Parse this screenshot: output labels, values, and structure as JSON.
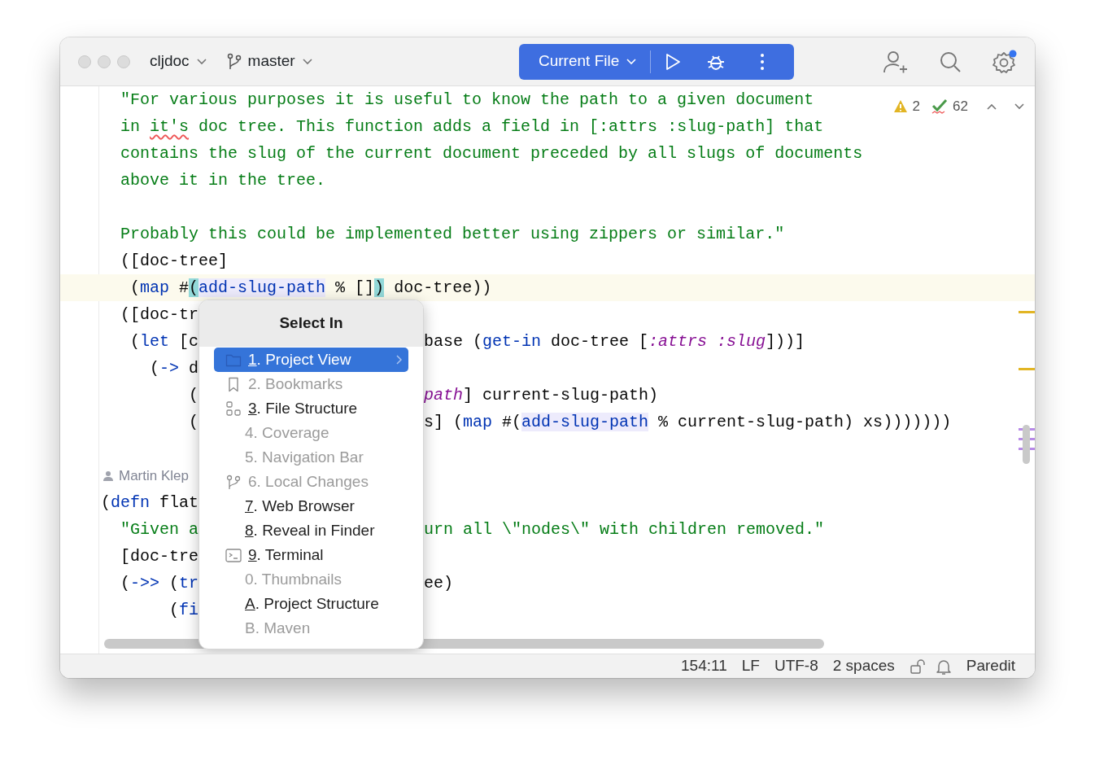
{
  "window": {
    "project": "cljdoc",
    "branch": "master",
    "run_config": "Current File"
  },
  "inspections": {
    "warnings": "2",
    "checks": "62"
  },
  "code_lines": [
    {
      "kind": "code",
      "current": false,
      "tokens": [
        {
          "kind": "string",
          "t": "  \"For various purposes it is useful to know the path to a given document"
        }
      ]
    },
    {
      "kind": "code",
      "current": false,
      "tokens": [
        {
          "kind": "string",
          "t": "  in "
        },
        {
          "kind": "typo",
          "t": "it's"
        },
        {
          "kind": "string",
          "t": " doc tree. This function adds a field in [:attrs :slug-path] that"
        }
      ]
    },
    {
      "kind": "code",
      "current": false,
      "tokens": [
        {
          "kind": "string",
          "t": "  contains the slug of the current document preceded by all slugs of documents"
        }
      ]
    },
    {
      "kind": "code",
      "current": false,
      "tokens": [
        {
          "kind": "string",
          "t": "  above it in the tree."
        }
      ]
    },
    {
      "kind": "blank",
      "current": false
    },
    {
      "kind": "code",
      "current": false,
      "tokens": [
        {
          "kind": "string",
          "t": "  Probably this could be implemented better using zippers or similar.\""
        }
      ]
    },
    {
      "kind": "code",
      "current": false,
      "tokens": [
        {
          "kind": "plain",
          "t": "  ([doc-tree]"
        }
      ]
    },
    {
      "kind": "code",
      "current": true,
      "tokens": [
        {
          "kind": "plain",
          "t": "   ("
        },
        {
          "kind": "call",
          "t": "map"
        },
        {
          "kind": "plain",
          "t": " #"
        },
        {
          "kind": "brace",
          "t": "("
        },
        {
          "kind": "usage",
          "t": "add-slug-path"
        },
        {
          "kind": "plain",
          "t": " % []"
        },
        {
          "kind": "brace",
          "t": ")"
        },
        {
          "kind": "plain",
          "t": " doc-tree))"
        }
      ]
    },
    {
      "kind": "split",
      "current": false,
      "left": [
        {
          "kind": "plain",
          "t": "  ([doc-tr"
        }
      ]
    },
    {
      "kind": "split",
      "current": false,
      "left": [
        {
          "kind": "plain",
          "t": "   ("
        },
        {
          "kind": "call",
          "t": "let"
        },
        {
          "kind": "plain",
          "t": " [c"
        }
      ],
      "right": [
        {
          "kind": "plain",
          "t": "base ("
        },
        {
          "kind": "call",
          "t": "get-in"
        },
        {
          "kind": "plain",
          "t": " doc-tree ["
        },
        {
          "kind": "keyword",
          "t": ":attrs :slug"
        },
        {
          "kind": "plain",
          "t": "]))]"
        }
      ]
    },
    {
      "kind": "split",
      "current": false,
      "left": [
        {
          "kind": "plain",
          "t": "     ("
        },
        {
          "kind": "call",
          "t": "->"
        },
        {
          "kind": "plain",
          "t": " d"
        }
      ]
    },
    {
      "kind": "split",
      "current": false,
      "left": [
        {
          "kind": "plain",
          "t": "         ("
        }
      ],
      "right": [
        {
          "kind": "keyword",
          "t": "path"
        },
        {
          "kind": "plain",
          "t": "] current-slug-path)"
        }
      ]
    },
    {
      "kind": "split",
      "current": false,
      "left": [
        {
          "kind": "plain",
          "t": "         ("
        }
      ],
      "right": [
        {
          "kind": "plain",
          "t": "s] ("
        },
        {
          "kind": "call",
          "t": "map"
        },
        {
          "kind": "plain",
          "t": " #("
        },
        {
          "kind": "usage",
          "t": "add-slug-path"
        },
        {
          "kind": "plain",
          "t": " % current-slug-path) xs)))))))"
        }
      ]
    },
    {
      "kind": "blank",
      "current": false
    },
    {
      "kind": "author",
      "current": false,
      "text": "Martin Klep"
    },
    {
      "kind": "split",
      "current": false,
      "left": [
        {
          "kind": "plain",
          "t": "("
        },
        {
          "kind": "call",
          "t": "defn"
        },
        {
          "kind": "plain",
          "t": " flat"
        }
      ]
    },
    {
      "kind": "split",
      "current": false,
      "left": [
        {
          "kind": "string",
          "t": "  \"Given a"
        }
      ],
      "right": [
        {
          "kind": "string",
          "t": "urn all \\\"nodes\\\" with children removed.\""
        }
      ]
    },
    {
      "kind": "split",
      "current": false,
      "left": [
        {
          "kind": "plain",
          "t": "  [doc-tre"
        }
      ]
    },
    {
      "kind": "split",
      "current": false,
      "left": [
        {
          "kind": "plain",
          "t": "  ("
        },
        {
          "kind": "call",
          "t": "->>"
        },
        {
          "kind": "plain",
          "t": " ("
        },
        {
          "kind": "call",
          "t": "tr"
        }
      ],
      "right": [
        {
          "kind": "plain",
          "t": "ee)"
        }
      ]
    },
    {
      "kind": "split",
      "current": false,
      "left": [
        {
          "kind": "plain",
          "t": "       ("
        },
        {
          "kind": "call",
          "t": "fi"
        }
      ]
    }
  ],
  "popup": {
    "title": "Select In",
    "items": [
      {
        "kind": "folder",
        "label": "1. Project View",
        "enabled": true,
        "selected": true,
        "submenu": true
      },
      {
        "kind": "bookmark",
        "label": "2. Bookmarks",
        "enabled": false,
        "selected": false,
        "submenu": false
      },
      {
        "kind": "structure",
        "label": "3. File Structure",
        "enabled": true,
        "selected": false,
        "submenu": false
      },
      {
        "kind": "plain",
        "label": "4. Coverage",
        "enabled": false,
        "selected": false,
        "submenu": false
      },
      {
        "kind": "plain",
        "label": "5. Navigation Bar",
        "enabled": false,
        "selected": false,
        "submenu": false
      },
      {
        "kind": "branch",
        "label": "6. Local Changes",
        "enabled": false,
        "selected": false,
        "submenu": false
      },
      {
        "kind": "plain",
        "label": "7. Web Browser",
        "enabled": true,
        "selected": false,
        "submenu": false
      },
      {
        "kind": "plain",
        "label": "8. Reveal in Finder",
        "enabled": true,
        "selected": false,
        "submenu": false
      },
      {
        "kind": "terminal",
        "label": "9. Terminal",
        "enabled": true,
        "selected": false,
        "submenu": false
      },
      {
        "kind": "plain",
        "label": "0. Thumbnails",
        "enabled": false,
        "selected": false,
        "submenu": false
      },
      {
        "kind": "plain",
        "label": "A. Project Structure",
        "enabled": true,
        "selected": false,
        "submenu": false
      },
      {
        "kind": "plain",
        "label": "B. Maven",
        "enabled": false,
        "selected": false,
        "submenu": false
      }
    ]
  },
  "status_bar": {
    "position": "154:11",
    "line_ending": "LF",
    "encoding": "UTF-8",
    "indent": "2 spaces",
    "mode": "Paredit"
  }
}
